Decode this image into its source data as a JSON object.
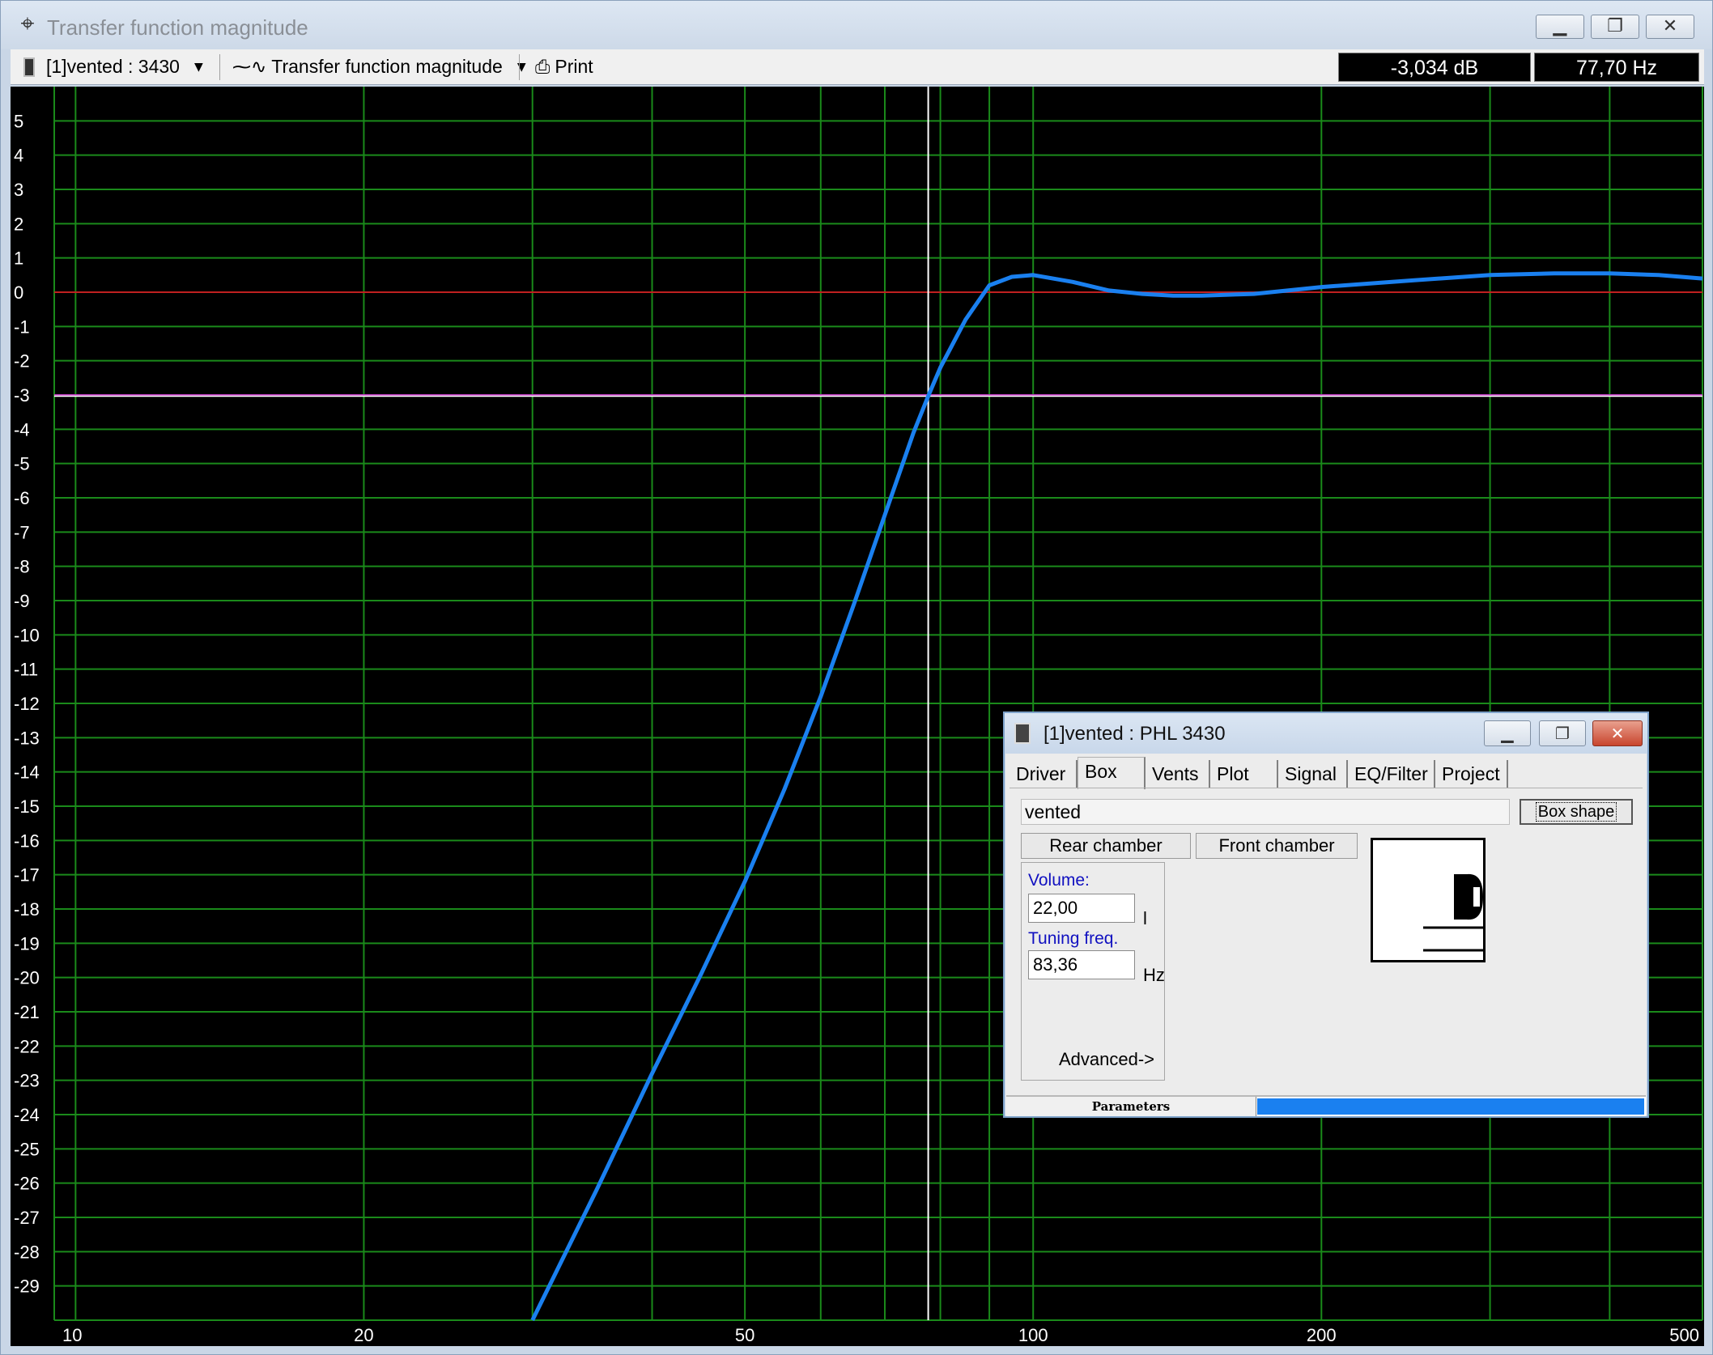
{
  "window": {
    "title": "Transfer function magnitude",
    "minimize_icon": "minimize-icon",
    "maximize_icon": "restore-icon",
    "close_icon": "close-icon"
  },
  "toolbar": {
    "box_selector": "[1]vented : 3430",
    "plot_selector": "Transfer function magnitude",
    "print_label": "Print",
    "readout_db": "-3,034 dB",
    "readout_hz": "77,70 Hz"
  },
  "chart_data": {
    "type": "line",
    "title": "",
    "xlabel": "",
    "ylabel": "",
    "x_scale": "log",
    "xlim": [
      9.5,
      500
    ],
    "ylim": [
      -30,
      6
    ],
    "x_tick_labels": [
      "10",
      "20",
      "50",
      "100",
      "200",
      "500"
    ],
    "y_tick_labels": [
      "5",
      "4",
      "3",
      "2",
      "1",
      "0",
      "-1",
      "-2",
      "-3",
      "-4",
      "-5",
      "-6",
      "-7",
      "-8",
      "-9",
      "-10",
      "-11",
      "-12",
      "-13",
      "-14",
      "-15",
      "-16",
      "-17",
      "-18",
      "-19",
      "-20",
      "-21",
      "-22",
      "-23",
      "-24",
      "-25",
      "-26",
      "-27",
      "-28",
      "-29"
    ],
    "grid": true,
    "reference_lines": [
      {
        "y": 0,
        "color": "#c02020"
      },
      {
        "y": -3,
        "color": "#c040c0"
      }
    ],
    "cursor": {
      "x": 77.7,
      "y": -3.034,
      "color": "#ffffff"
    },
    "series": [
      {
        "color": "#1a80f0",
        "x": [
          30,
          35,
          40,
          45,
          50,
          55,
          60,
          65,
          70,
          75,
          77.7,
          80,
          85,
          90,
          95,
          100,
          110,
          120,
          130,
          140,
          150,
          170,
          200,
          250,
          300,
          350,
          400,
          450,
          500
        ],
        "y": [
          -30,
          -26.2,
          -22.8,
          -19.9,
          -17.2,
          -14.5,
          -11.8,
          -9.1,
          -6.5,
          -4.1,
          -3.03,
          -2.2,
          -0.8,
          0.2,
          0.45,
          0.5,
          0.3,
          0.05,
          -0.05,
          -0.1,
          -0.1,
          -0.05,
          0.15,
          0.35,
          0.5,
          0.55,
          0.55,
          0.5,
          0.4
        ]
      }
    ]
  },
  "subwindow": {
    "title": "[1]vented : PHL 3430",
    "tabs": [
      "Driver",
      "Box",
      "Vents",
      "Plot",
      "Signal",
      "EQ/Filter",
      "Project"
    ],
    "active_tab": "Box",
    "box_type": "vented",
    "box_shape_button": "Box shape",
    "rear_chamber_button": "Rear chamber",
    "front_chamber_button": "Front chamber",
    "volume_label": "Volume:",
    "volume_value": "22,00",
    "volume_unit": "l",
    "tuning_label": "Tuning freq.",
    "tuning_value": "83,36",
    "tuning_unit": "Hz",
    "advanced_label": "Advanced->",
    "status_label": "Parameters"
  }
}
